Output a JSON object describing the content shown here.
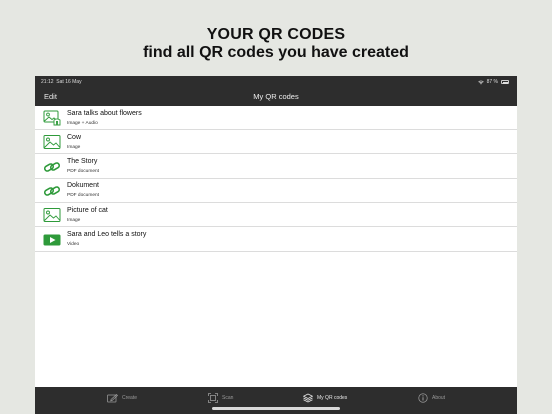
{
  "promo": {
    "title": "YOUR QR CODES",
    "subtitle": "find all QR codes you have created"
  },
  "status": {
    "time": "21:12",
    "date": "Sat 16 May",
    "battery": "87 %"
  },
  "nav": {
    "edit_label": "Edit",
    "title": "My QR codes"
  },
  "items": [
    {
      "title": "Sara talks about flowers",
      "type": "Image + Audio",
      "icon": "image-audio-icon"
    },
    {
      "title": "Cow",
      "type": "Image",
      "icon": "image-icon"
    },
    {
      "title": "The Story",
      "type": "PDF document",
      "icon": "link-icon"
    },
    {
      "title": "Dokument",
      "type": "PDF document",
      "icon": "link-icon"
    },
    {
      "title": "Picture of cat",
      "type": "Image",
      "icon": "image-icon"
    },
    {
      "title": "Sara and Leo tells a story",
      "type": "Video",
      "icon": "video-play-icon"
    }
  ],
  "tabs": [
    {
      "label": "Create",
      "icon": "create-icon"
    },
    {
      "label": "Scan",
      "icon": "scan-icon"
    },
    {
      "label": "My QR codes",
      "icon": "layers-icon",
      "active": true
    },
    {
      "label": "About",
      "icon": "info-icon"
    }
  ],
  "colors": {
    "accent_green": "#2e9a3a",
    "bar_dark": "#2d2d2d",
    "background": "#e5e7e2"
  }
}
